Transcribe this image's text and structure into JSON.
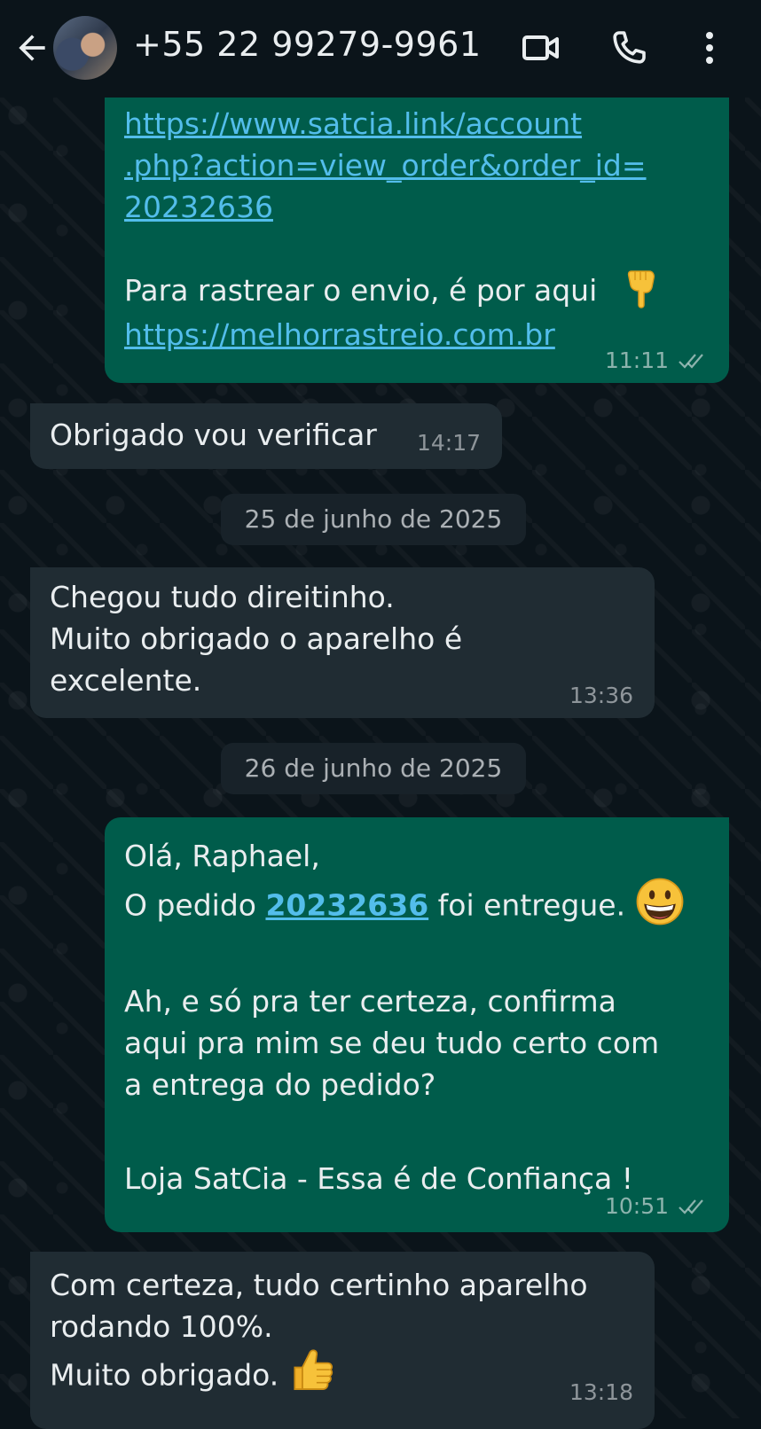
{
  "header": {
    "contact_name": "+55 22 99279-9961",
    "back_icon": "arrow-left-icon",
    "video_icon": "video-camera-icon",
    "call_icon": "phone-icon",
    "menu_icon": "more-vertical-icon"
  },
  "messages": [
    {
      "direction": "outgoing",
      "link_lines": [
        "https://www.satcia.link/account",
        ".php?action=view_order&order_id=",
        "20232636"
      ],
      "text": "Para rastrear o envio, é por aqui",
      "emoji": "pointing-down-hand-emoji",
      "link2": "https://melhorrastreio.com.br",
      "time": "11:11",
      "status": "read"
    },
    {
      "direction": "incoming",
      "lines": [
        "Obrigado vou verificar"
      ],
      "time": "14:17"
    },
    {
      "direction": "date",
      "label": "25 de junho de 2025"
    },
    {
      "direction": "incoming",
      "lines": [
        "Chegou tudo direitinho.",
        "Muito obrigado o aparelho é",
        "excelente."
      ],
      "time": "13:36"
    },
    {
      "direction": "date",
      "label": "26 de junho de 2025"
    },
    {
      "direction": "outgoing",
      "greeting": "Olá, Raphael,",
      "order_prefix": "O pedido ",
      "order_id": "20232636",
      "order_suffix": " foi entregue.",
      "order_emoji": "grinning-face-emoji",
      "lines": [
        "Ah, e só pra ter certeza, confirma",
        "aqui pra mim se deu tudo certo com",
        "a entrega do pedido?"
      ],
      "signature": "Loja SatCia - Essa é de Confiança !",
      "time": "10:51",
      "status": "read"
    },
    {
      "direction": "incoming",
      "lines": [
        "Com certeza, tudo certinho aparelho",
        "rodando 100%."
      ],
      "last_line": "Muito obrigado.",
      "last_emoji": "thumbs-up-emoji",
      "time": "13:18"
    }
  ],
  "colors": {
    "background": "#0b141a",
    "outgoing_bubble": "#005c4b",
    "incoming_bubble": "#202c33",
    "link": "#53bdeb"
  }
}
